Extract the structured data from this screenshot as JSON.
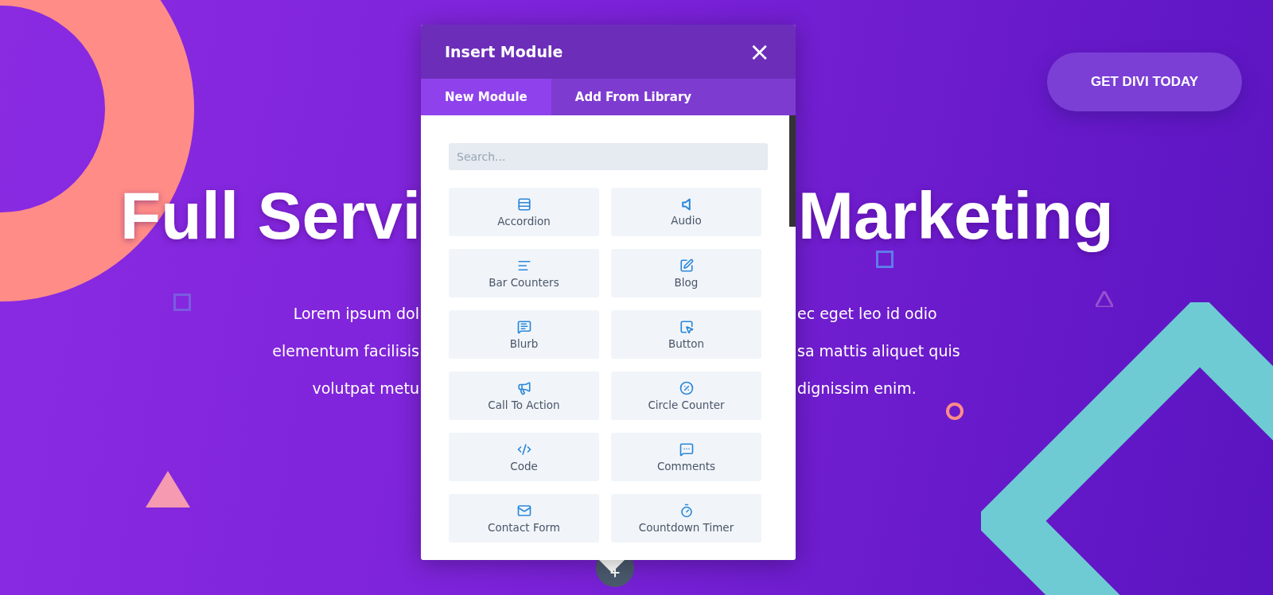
{
  "hero": {
    "headline_left": "Full Servi",
    "headline_right": "Marketing",
    "lines": [
      {
        "left": "Lorem ipsum dol",
        "right": "ec eget leo id odio"
      },
      {
        "left": "elementum facilisis",
        "right": "sa mattis aliquet quis"
      },
      {
        "left": "volutpat metu",
        "right": "dignissim enim."
      }
    ]
  },
  "cta_button": "GET DIVI TODAY",
  "modal": {
    "title": "Insert Module",
    "close": "×",
    "tabs": [
      {
        "label": "New Module",
        "selected": true
      },
      {
        "label": "Add From Library",
        "selected": false
      }
    ],
    "search": {
      "placeholder": "Search..."
    },
    "modules": [
      {
        "label": "Accordion"
      },
      {
        "label": "Audio"
      },
      {
        "label": "Bar Counters"
      },
      {
        "label": "Blog"
      },
      {
        "label": "Blurb"
      },
      {
        "label": "Button"
      },
      {
        "label": "Call To Action"
      },
      {
        "label": "Circle Counter"
      },
      {
        "label": "Code"
      },
      {
        "label": "Comments"
      },
      {
        "label": "Contact Form"
      },
      {
        "label": "Countdown Timer"
      }
    ]
  }
}
